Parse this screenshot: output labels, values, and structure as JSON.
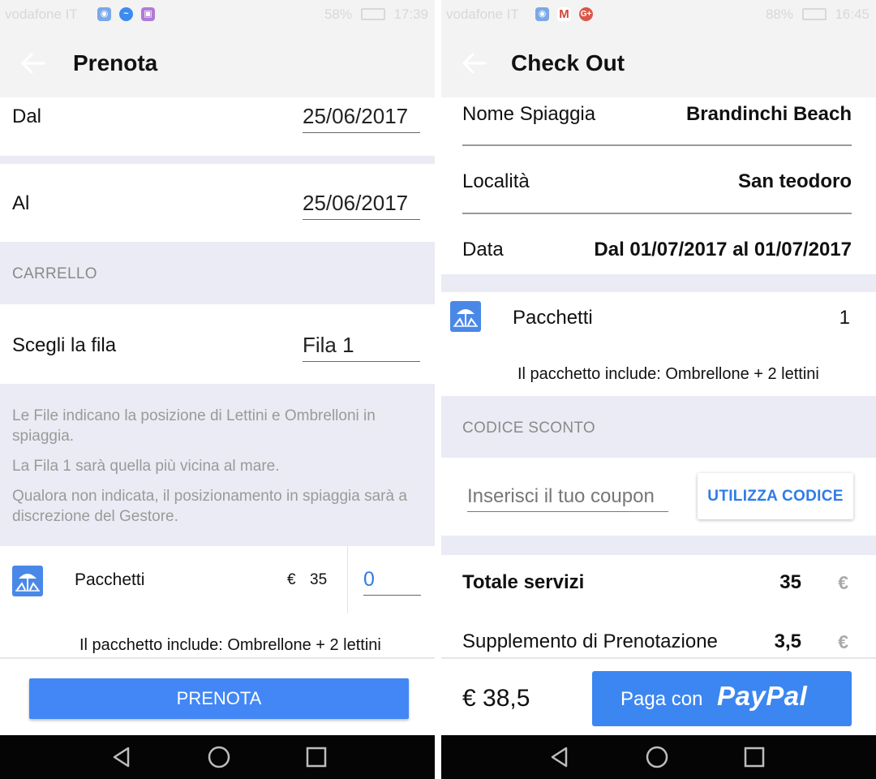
{
  "left": {
    "status": {
      "carrier": "vodafone IT",
      "battery": "58%",
      "time": "17:39"
    },
    "header": {
      "title": "Prenota"
    },
    "dal": {
      "label": "Dal",
      "value": "25/06/2017"
    },
    "al": {
      "label": "Al",
      "value": "25/06/2017"
    },
    "carrello": {
      "title": "CARRELLO"
    },
    "fila": {
      "label": "Scegli la fila",
      "value": "Fila 1"
    },
    "info": [
      "Le File indicano la posizione di Lettini e Ombrelloni in spiaggia.",
      "La Fila 1 sarà quella più vicina al mare.",
      "Qualora non indicata, il posizionamento in spiaggia sarà a discrezione del Gestore."
    ],
    "package": {
      "label": "Pacchetti",
      "currency": "€",
      "price": "35",
      "quantity": "0",
      "includes": "Il pacchetto include: Ombrellone + 2 lettini"
    },
    "button": {
      "label": "PRENOTA"
    }
  },
  "right": {
    "status": {
      "carrier": "vodafone IT",
      "battery": "88%",
      "time": "16:45"
    },
    "header": {
      "title": "Check Out"
    },
    "details": [
      {
        "label": "Nome Spiaggia",
        "value": "Brandinchi Beach"
      },
      {
        "label": "Località",
        "value": "San teodoro"
      },
      {
        "label": "Data",
        "value": "Dal 01/07/2017 al 01/07/2017"
      }
    ],
    "package": {
      "label": "Pacchetti",
      "quantity": "1",
      "includes": "Il pacchetto include: Ombrellone + 2 lettini"
    },
    "coupon": {
      "title": "CODICE SCONTO",
      "placeholder": "Inserisci il tuo coupon",
      "button": "UTILIZZA CODICE"
    },
    "totals": [
      {
        "label": "Totale servizi",
        "value": "35",
        "currency": "€"
      },
      {
        "label": "Supplemento di Prenotazione",
        "value": "3,5",
        "currency": "€"
      }
    ],
    "grand_total": "€ 38,5",
    "paypal": {
      "prefix": "Paga con",
      "brand": "PayPal"
    }
  },
  "colors": {
    "accent": "#4287f5",
    "band": "#ebebf5",
    "header": "#f3f3f3",
    "navbar": "#050505"
  },
  "icons": [
    "back-arrow-icon",
    "beach-umbrella-icon",
    "nav-back-icon",
    "nav-home-icon",
    "nav-recents-icon"
  ]
}
